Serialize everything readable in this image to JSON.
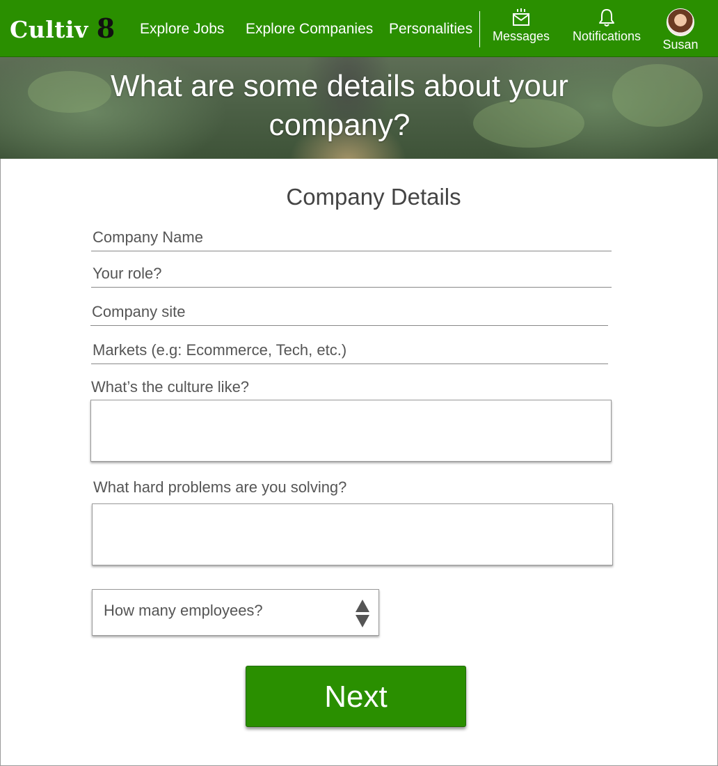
{
  "nav": {
    "logo_text": "Cultiv",
    "logo_number": "8",
    "links": [
      "Explore Jobs",
      "Explore Companies",
      "Personalities"
    ],
    "messages_label": "Messages",
    "notifications_label": "Notifications",
    "user_name": "Susan",
    "brand_color": "#2a8f00"
  },
  "hero": {
    "title_line1": "What are some details about your",
    "title_line2": "company?"
  },
  "form": {
    "heading": "Company Details",
    "company_name_placeholder": "Company Name",
    "role_placeholder": "Your role?",
    "site_placeholder": "Company site",
    "markets_placeholder": "Markets (e.g: Ecommerce, Tech, etc.)",
    "culture_label": "What’s the culture like?",
    "culture_value": "",
    "problems_label": "What hard problems are you solving?",
    "problems_value": "",
    "employees_select": "How many employees?",
    "next_label": "Next"
  }
}
